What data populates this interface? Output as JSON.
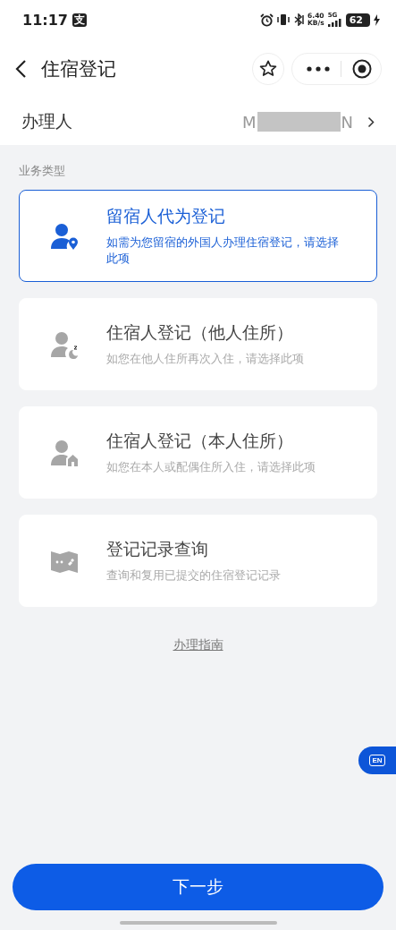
{
  "status_bar": {
    "time": "11:17",
    "app_badge": "支",
    "speed": "6.40",
    "speed_unit": "KB/s",
    "network": "5G",
    "battery": "62"
  },
  "nav": {
    "title": "住宿登记"
  },
  "handler": {
    "label": "办理人",
    "value_start": "M",
    "value_end": "N"
  },
  "section_label": "业务类型",
  "options": [
    {
      "kind": "person-pin",
      "title": "留宿人代为登记",
      "description": "如需为您留宿的外国人办理住宿登记，请选择此项",
      "selected": true
    },
    {
      "kind": "person-moon",
      "title": "住宿人登记（他人住所）",
      "description": "如您在他人住所再次入住，请选择此项",
      "selected": false
    },
    {
      "kind": "person-home",
      "title": "住宿人登记（本人住所）",
      "description": "如您在本人或配偶住所入住，请选择此项",
      "selected": false
    },
    {
      "kind": "map",
      "title": "登记记录查询",
      "description": "查询和复用已提交的住宿登记记录",
      "selected": false
    }
  ],
  "guide_link": "办理指南",
  "language_badge": "EN",
  "next_button": "下一步"
}
